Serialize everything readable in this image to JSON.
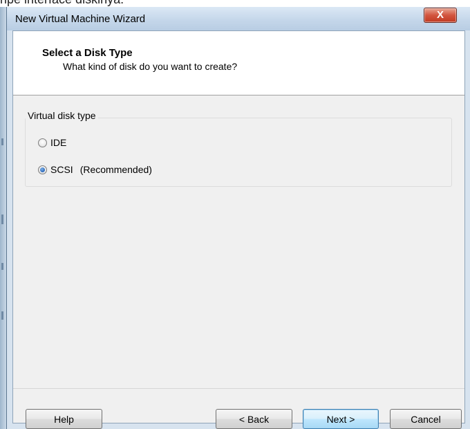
{
  "background_text": "ripe interface diskinya.",
  "window": {
    "title": "New Virtual Machine Wizard",
    "close_glyph": "X"
  },
  "header": {
    "title": "Select a Disk Type",
    "subtitle": "What kind of disk do you want to create?"
  },
  "disk_type_group": {
    "legend": "Virtual disk type",
    "options": [
      {
        "label": "IDE",
        "note": "",
        "selected": false
      },
      {
        "label": "SCSI",
        "note": "(Recommended)",
        "selected": true
      }
    ]
  },
  "buttons": {
    "help": "Help",
    "back": "< Back",
    "next": "Next >",
    "cancel": "Cancel"
  },
  "colors": {
    "titlebar": "#c5d7ea",
    "close_button": "#c23a22",
    "dialog_body": "#f0f0f0",
    "default_button_border": "#3c7fb1"
  },
  "icons": [
    "close-icon",
    "radio-unchecked-icon",
    "radio-checked-icon"
  ]
}
